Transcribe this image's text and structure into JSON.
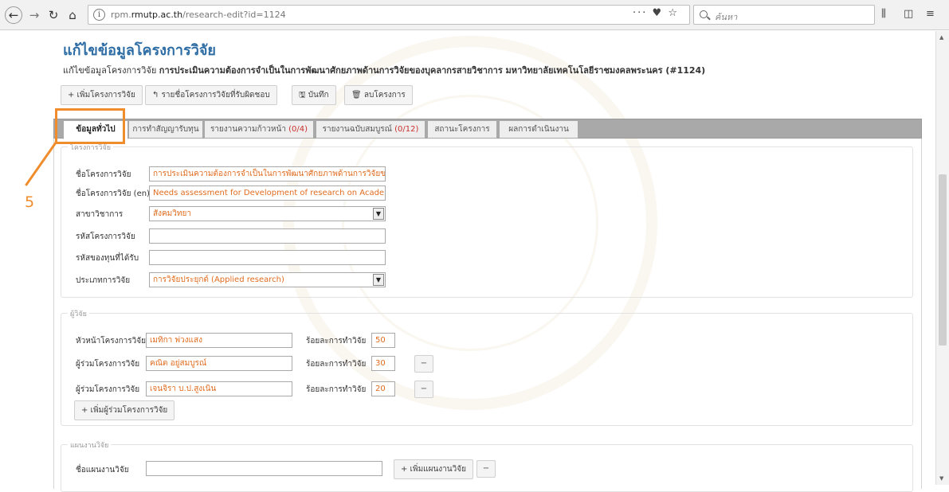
{
  "browser": {
    "url_prefix": "rpm.",
    "url_domain": "rmutp.ac.th",
    "url_path": "/research-edit?id=1124",
    "url_actions": "··· ♥ ☆",
    "search_placeholder": "ค้นหา"
  },
  "page": {
    "title": "แก้ไขข้อมูลโครงการวิจัย",
    "subtitle_prefix": "แก้ไขข้อมูลโครงการวิจัย",
    "subtitle_bold": "การประเมินความต้องการจำเป็นในการพัฒนาศักยภาพด้านการวิจัยของบุคลากรสายวิชาการ มหาวิทยาลัยเทคโนโลยีราชมงคลพระนคร (#1124)"
  },
  "toolbar": {
    "add_project": "+ เพิ่มโครงการวิจัย",
    "responsible_list": "↰ รายชื่อโครงการวิจัยที่รับผิดชอบ",
    "save": "🖫 บันทึก",
    "delete_project": "🗑 ลบโครงการ"
  },
  "tabs": [
    {
      "label": "ข้อมูลทั่วไป",
      "count": ""
    },
    {
      "label": "การทำสัญญารับทุน",
      "count": ""
    },
    {
      "label": "รายงานความก้าวหน้า",
      "count": "(0/4)"
    },
    {
      "label": "รายงานฉบับสมบูรณ์",
      "count": "(0/12)"
    },
    {
      "label": "สถานะโครงการ",
      "count": ""
    },
    {
      "label": "ผลการดำเนินงาน",
      "count": ""
    }
  ],
  "project": {
    "legend": "โครงการวิจัย",
    "name_label": "ชื่อโครงการวิจัย",
    "name_value": "การประเมินความต้องการจำเป็นในการพัฒนาศักยภาพด้านการวิจัยขอ",
    "name_en_label": "ชื่อโครงการวิจัย (en)",
    "name_en_value": "Needs  assessment for Development of research on Academic St",
    "field_label": "สาขาวิชาการ",
    "field_value": "สังคมวิทยา",
    "code_label": "รหัสโครงการวิจัย",
    "code_value": "",
    "fund_code_label": "รหัสของทุนที่ได้รับ",
    "fund_code_value": "",
    "type_label": "ประเภทการวิจัย",
    "type_value": "การวิจัยประยุกต์ (Applied research)"
  },
  "researchers": {
    "legend": "ผู้วิจัย",
    "percent_label": "ร้อยละการทำวิจัย",
    "rows": [
      {
        "role": "หัวหน้าโครงการวิจัย",
        "name": "เมทิกา พ่วงแสง",
        "percent": "50"
      },
      {
        "role": "ผู้ร่วมโครงการวิจัย",
        "name": "คณิต อยู่สมบูรณ์",
        "percent": "30"
      },
      {
        "role": "ผู้ร่วมโครงการวิจัย",
        "name": "เจนจิรา บ.ป.สูงเนิน",
        "percent": "20"
      }
    ],
    "add_label": "+ เพิ่มผู้ร่วมโครงการวิจัย"
  },
  "plan": {
    "legend": "แผนงานวิจัย",
    "name_label": "ชื่อแผนงานวิจัย",
    "name_value": "",
    "add_label": "+ เพิ่มแผนงานวิจัย"
  },
  "annotation": {
    "number": "5",
    "color": "#ef8c2c"
  }
}
